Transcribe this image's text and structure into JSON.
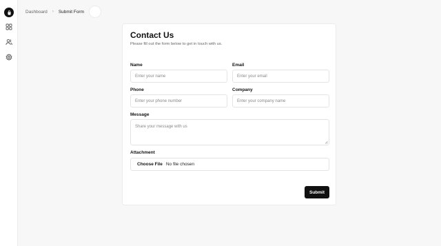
{
  "breadcrumb": {
    "parent": "Dashboard",
    "separator": "›",
    "current": "Submit Form"
  },
  "sidebar": {
    "logo_icon": "bag-logo-icon",
    "items": [
      {
        "icon": "grid-icon"
      },
      {
        "icon": "users-icon"
      },
      {
        "icon": "gear-icon"
      }
    ]
  },
  "form": {
    "title": "Contact Us",
    "subtitle": "Please fill out the form below to get in touch with us.",
    "fields": {
      "name": {
        "label": "Name",
        "placeholder": "Enter your name"
      },
      "email": {
        "label": "Email",
        "placeholder": "Enter your email"
      },
      "phone": {
        "label": "Phone",
        "placeholder": "Enter your phone number"
      },
      "company": {
        "label": "Company",
        "placeholder": "Enter your company name"
      },
      "message": {
        "label": "Message",
        "placeholder": "Share your message with us"
      },
      "attachment": {
        "label": "Attachment",
        "button": "Choose File",
        "status": "No file chosen"
      }
    },
    "submit_label": "Submit"
  },
  "colors": {
    "background": "#f7f7f8",
    "card": "#ffffff",
    "border": "#e4e4e7",
    "primary_button": "#111111",
    "text": "#111111",
    "muted_text": "#666666"
  }
}
